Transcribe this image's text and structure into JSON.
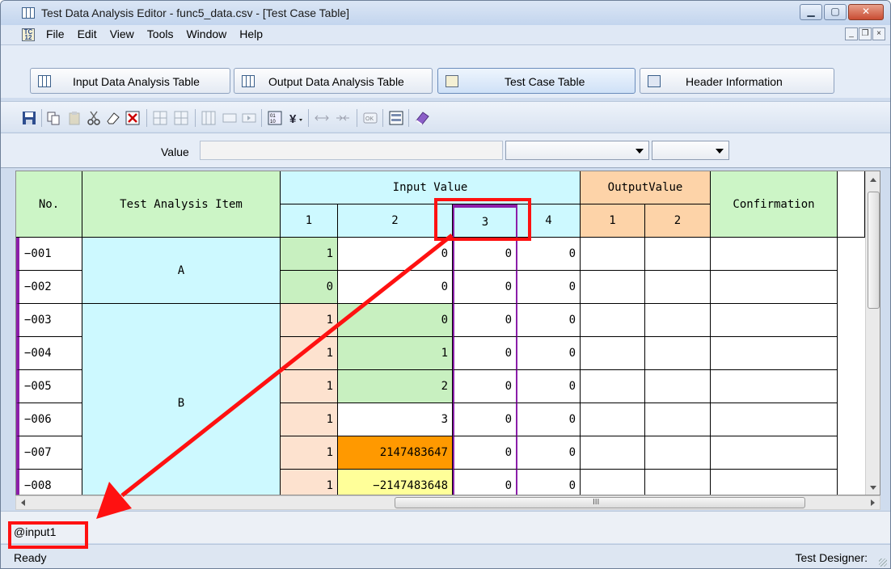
{
  "window": {
    "title": "Test Data Analysis Editor - func5_data.csv - [Test Case Table]",
    "buttons": {
      "minimize": "▁",
      "maximize": "▢",
      "close": "✕"
    }
  },
  "menu": {
    "icon_text": "TC 12",
    "items": [
      "File",
      "Edit",
      "View",
      "Tools",
      "Window",
      "Help"
    ],
    "mdi": {
      "minimize": "_",
      "restore": "❐",
      "close": "×"
    }
  },
  "tabs": [
    {
      "label": "Input Data Analysis Table",
      "icon": "table-icon",
      "active": false
    },
    {
      "label": "Output Data Analysis Table",
      "icon": "table-icon",
      "active": false
    },
    {
      "label": "Test Case Table",
      "icon": "testcase-icon",
      "active": true
    },
    {
      "label": "Header Information",
      "icon": "abc-icon",
      "active": false
    }
  ],
  "value_bar": {
    "label": "Value",
    "input_value": ""
  },
  "table": {
    "headers": {
      "no": "No.",
      "item": "Test Analysis Item",
      "input_group": "Input Value",
      "output_group": "OutputValue",
      "confirmation": "Confirmation",
      "input_cols": [
        "1",
        "2",
        "3",
        "4"
      ],
      "output_cols": [
        "1",
        "2"
      ]
    },
    "groups": [
      {
        "label": "A",
        "rows": 2
      },
      {
        "label": "B",
        "rows": 6
      }
    ],
    "rows": [
      {
        "no": "−001",
        "inputs": [
          "1",
          "0",
          "0",
          "0"
        ]
      },
      {
        "no": "−002",
        "inputs": [
          "0",
          "0",
          "0",
          "0"
        ]
      },
      {
        "no": "−003",
        "inputs": [
          "1",
          "0",
          "0",
          "0"
        ]
      },
      {
        "no": "−004",
        "inputs": [
          "1",
          "1",
          "0",
          "0"
        ]
      },
      {
        "no": "−005",
        "inputs": [
          "1",
          "2",
          "0",
          "0"
        ]
      },
      {
        "no": "−006",
        "inputs": [
          "1",
          "3",
          "0",
          "0"
        ]
      },
      {
        "no": "−007",
        "inputs": [
          "1",
          "2147483647",
          "0",
          "0"
        ]
      },
      {
        "no": "−008",
        "inputs": [
          "1",
          "−2147483648",
          "0",
          "0"
        ]
      }
    ],
    "colors": {
      "header_green": "#ccf5c6",
      "header_cyan": "#cdf9ff",
      "header_orange": "#fdd3a8",
      "item_cyan": "#cdf9ff",
      "green_cell": "#c8f0c0",
      "peach_cell": "#fde2cf",
      "orange_cell": "#ff9900",
      "yellow_cell": "#ffff99",
      "selected_col_border": "#8b1fa9"
    }
  },
  "scrollbar_grip": "III",
  "cell_reference": "@input1",
  "status": {
    "left": "Ready",
    "right": "Test Designer:"
  },
  "annotation_color": "#ff1111"
}
